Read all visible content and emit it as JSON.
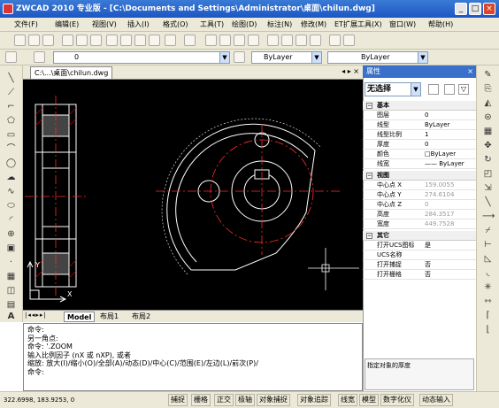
{
  "window": {
    "title": "ZWCAD 2010 专业版 - [C:\\Documents and Settings\\Administrator\\桌面\\chilun.dwg]",
    "min_label": "_",
    "max_label": "□",
    "close_label": "×"
  },
  "menu": {
    "items": [
      "文件(F)",
      "编辑(E)",
      "视图(V)",
      "插入(I)",
      "格式(O)",
      "工具(T)",
      "绘图(D)",
      "标注(N)",
      "修改(M)",
      "ET扩展工具(X)",
      "窗口(W)",
      "帮助(H)"
    ]
  },
  "layer_bar": {
    "layer_value": "0",
    "color_value": "ByLayer",
    "linetype_value": "ByLayer"
  },
  "document": {
    "tab_label": "C:\\...\\桌面\\chilun.dwg"
  },
  "sheet_tabs": [
    "Model",
    "布局1",
    "布局2"
  ],
  "properties": {
    "title": "属性",
    "selection": "无选择",
    "groups": [
      {
        "name": "基本",
        "rows": [
          {
            "key": "图层",
            "value": "0"
          },
          {
            "key": "线型",
            "value": "ByLayer"
          },
          {
            "key": "线型比例",
            "value": "1"
          },
          {
            "key": "厚度",
            "value": "0"
          },
          {
            "key": "颜色",
            "value": "□ByLayer"
          },
          {
            "key": "线宽",
            "value": "—— ByLayer"
          }
        ]
      },
      {
        "name": "视图",
        "rows": [
          {
            "key": "中心点 X",
            "value": "159.0055"
          },
          {
            "key": "中心点 Y",
            "value": "274.6104"
          },
          {
            "key": "中心点 Z",
            "value": "0"
          },
          {
            "key": "高度",
            "value": "284.3517"
          },
          {
            "key": "宽度",
            "value": "449.7528"
          }
        ]
      },
      {
        "name": "其它",
        "rows": [
          {
            "key": "打开UCS图标",
            "value": "是"
          },
          {
            "key": "UCS名称",
            "value": ""
          },
          {
            "key": "打开捕捉",
            "value": "否"
          },
          {
            "key": "打开栅格",
            "value": "否"
          }
        ]
      }
    ],
    "description": "指定对象的厚度"
  },
  "command_lines": [
    "命令:",
    "另一角点:",
    "命令: '.ZOOM",
    "输入比例因子 (nX 或 nXP), 或者",
    "缩放:  放大(I)/缩小(O)/全部(A)/动态(D)/中心(C)/范围(E)/左边(L)/前次(P)/",
    "命令:"
  ],
  "status": {
    "coords": "322.6998,  183.9253,  0",
    "buttons": [
      "捕捉",
      "栅格",
      "正交",
      "极轴",
      "对象捕捉",
      "对象追踪",
      "线宽",
      "模型",
      "数字化仪",
      "动态输入"
    ]
  },
  "colors": {
    "titlebar": "#1d56c4",
    "canvas": "#000000",
    "drawing_red": "#ff2a2a",
    "drawing_white": "#ffffff"
  }
}
